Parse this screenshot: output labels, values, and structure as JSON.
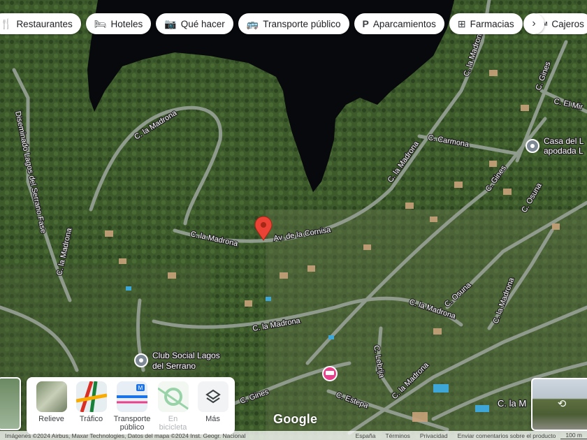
{
  "chips": [
    {
      "icon": "restaurant-icon",
      "label": "Restaurantes"
    },
    {
      "icon": "hotel-icon",
      "label": "Hoteles"
    },
    {
      "icon": "camera-icon",
      "label": "Qué hacer"
    },
    {
      "icon": "bus-icon",
      "label": "Transporte público"
    },
    {
      "icon": "parking-icon",
      "label": "Aparcamientos"
    },
    {
      "icon": "pharmacy-icon",
      "label": "Farmacias"
    },
    {
      "icon": "atm-icon",
      "label": "Cajeros"
    }
  ],
  "streets": {
    "madrona_top": "C. la Madrona",
    "diseminado": "Diseminado Lagos del Serrano Fase",
    "madrona_left": "C. la Madrona",
    "madrona_center": "C. la Madrona",
    "cornisa": "Av. de la Cornisa",
    "madrona_diag": "C. la Madrona",
    "carmona": "C. Carmona",
    "gines_ne": "C. Gines",
    "mir": "C. El Mir",
    "gines_mid": "C. Gines",
    "osuna_e": "C. Osuna",
    "madrona_lower": "C. la Madrona",
    "madrona_mid": "C. la Madrona",
    "osuna_se": "C. Osuna",
    "madrona_se": "C. la Madrona",
    "lebrija": "C. Lebrija",
    "madrona_bottom": "C. la Madrona",
    "gines_bottom": "C. Gines",
    "estepa": "C. Estepa",
    "madrona_br": "C. la M"
  },
  "pois": {
    "casa_line1": "Casa del L",
    "casa_line2": "apodada L",
    "club_line1": "Club Social Lagos",
    "club_line2": "del Serrano"
  },
  "layers": [
    {
      "icon": "terrain-icon",
      "label": "Relieve",
      "disabled": false
    },
    {
      "icon": "traffic-icon",
      "label": "Tráfico",
      "disabled": false
    },
    {
      "icon": "transit-icon",
      "label": "Transporte público",
      "disabled": false
    },
    {
      "icon": "bicycle-icon",
      "label": "En bicicleta",
      "disabled": true
    },
    {
      "icon": "layers-icon",
      "label": "Más",
      "disabled": false
    }
  ],
  "logo": "Google",
  "footer": {
    "attribution": "Imágenes ©2024 Airbus, Maxar Technologies, Datos del mapa ©2024 Inst. Geogr. Nacional",
    "region": "España",
    "terms": "Términos",
    "privacy": "Privacidad",
    "feedback": "Enviar comentarios sobre el producto",
    "scale": "100 m"
  },
  "colors": {
    "pin": "#ea4335",
    "poi_gray": "#7d8a96",
    "poi_pink": "#e8408a"
  }
}
